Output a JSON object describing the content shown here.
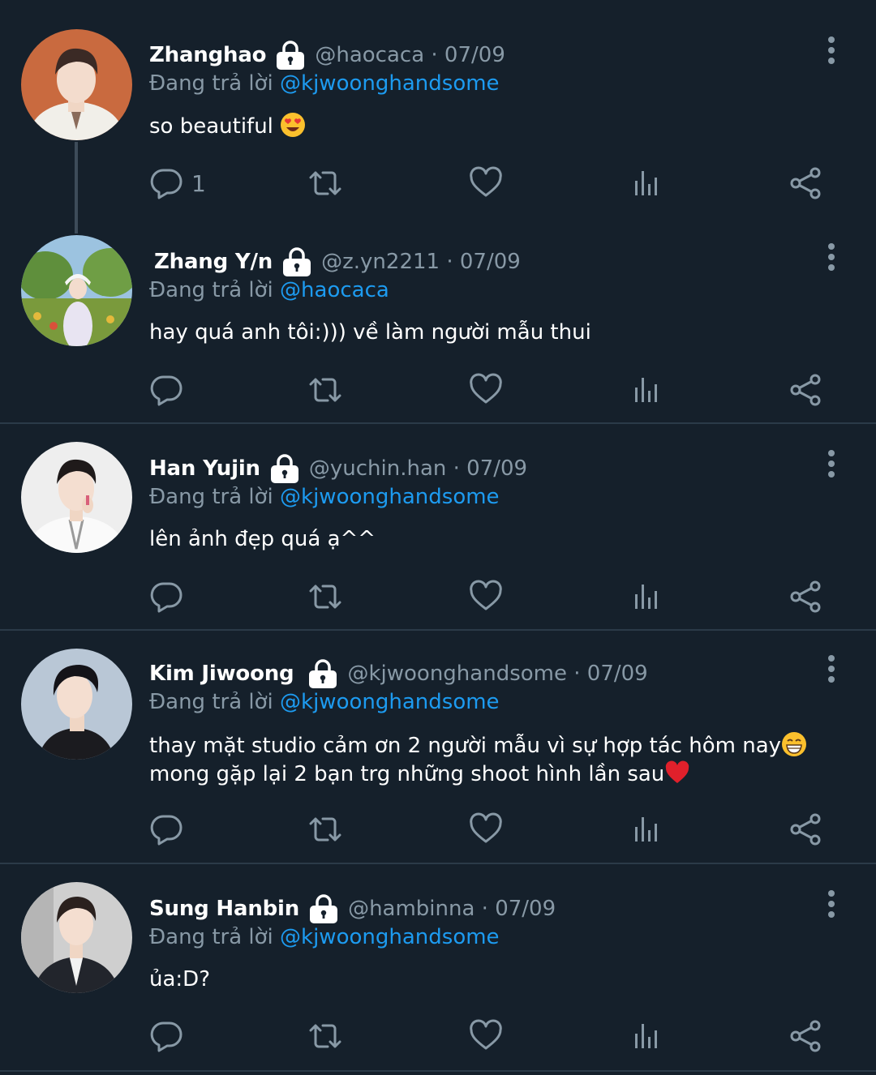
{
  "colors": {
    "background": "#15202b",
    "secondary_text": "#8899a6",
    "mention": "#1d9bf0",
    "divider": "#2b3a48"
  },
  "reply_prefix": "Đang trả lời",
  "tweets": [
    {
      "name": "Zhanghao",
      "handle_date": "@haocaca · 07/09",
      "mention": "@kjwoonghandsome",
      "text": "so beautiful",
      "emoji": "heart-eyes-emoji",
      "reply_count": "1",
      "avatar": "avatar-zhanghao"
    },
    {
      "name": "Zhang Y/n",
      "handle_date": "@z.yn2211 · 07/09",
      "mention": "@haocaca",
      "text": "hay quá anh tôi:))) về làm người mẫu thui",
      "reply_count": "",
      "avatar": "avatar-zhang-yn"
    },
    {
      "name": "Han Yujin",
      "handle_date": "@yuchin.han · 07/09",
      "mention": "@kjwoonghandsome",
      "text": "lên ảnh đẹp quá ạ^^",
      "reply_count": "",
      "avatar": "avatar-han-yujin"
    },
    {
      "name": "Kim Jiwoong",
      "handle_date": "@kjwoonghandsome · 07/09",
      "mention": "@kjwoonghandsome",
      "text_part1": "thay mặt studio cảm ơn 2 người mẫu vì sự hợp tác hôm nay",
      "text_part2": " mong gặp lại 2 bạn trg những shoot hình lần sau",
      "emojis": [
        "grinning-emoji",
        "red-heart-emoji"
      ],
      "reply_count": "",
      "avatar": "avatar-kim-jiwoong"
    },
    {
      "name": "Sung Hanbin",
      "handle_date": "@hambinna · 07/09",
      "mention": "@kjwoonghandsome",
      "text": "ủa:D?",
      "reply_count": "",
      "avatar": "avatar-sung-hanbin"
    }
  ]
}
